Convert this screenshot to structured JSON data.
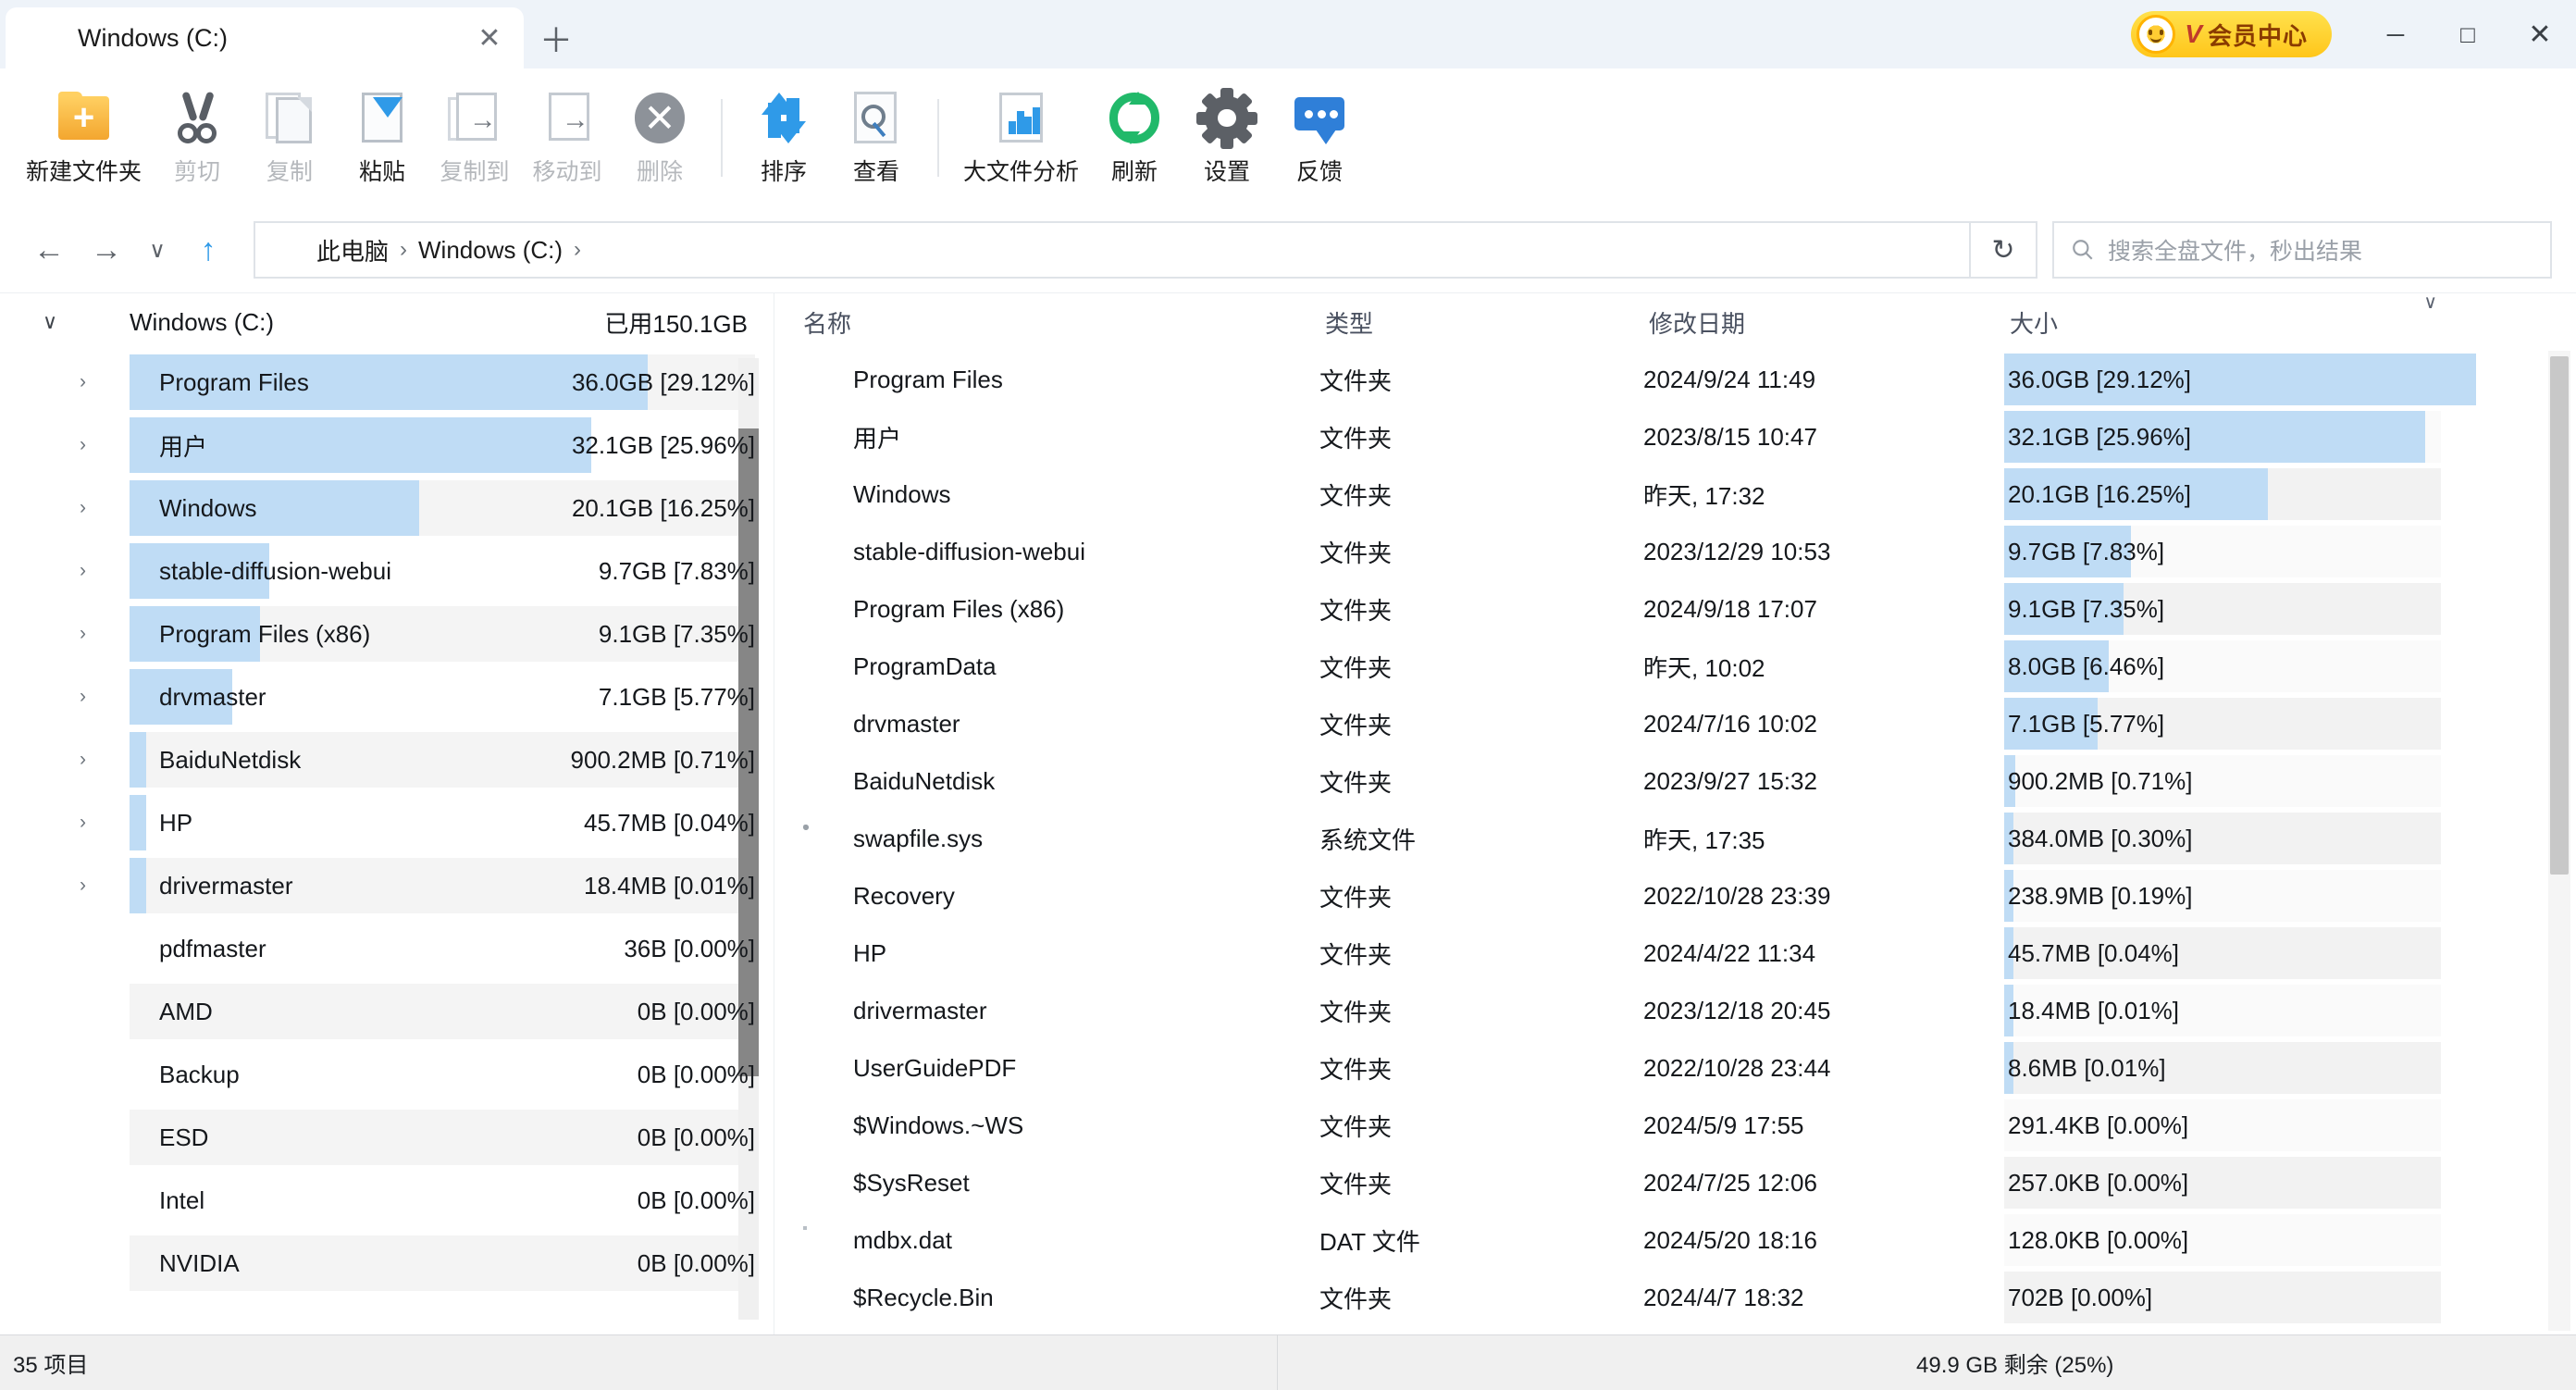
{
  "titlebar": {
    "tab_title": "Windows (C:)",
    "tab_icon": "drive-icon",
    "close_tab_glyph": "✕",
    "new_tab_glyph": "＋",
    "vip": {
      "v_letter": "V",
      "label": "会员中心"
    },
    "minimize_glyph": "─",
    "maximize_glyph": "□",
    "close_glyph": "✕"
  },
  "toolbar": {
    "buttons": [
      {
        "label": "新建文件夹",
        "icon": "new-folder-icon",
        "enabled": true
      },
      {
        "label": "剪切",
        "icon": "cut-icon",
        "enabled": false
      },
      {
        "label": "复制",
        "icon": "copy-icon",
        "enabled": false
      },
      {
        "label": "粘贴",
        "icon": "paste-icon",
        "enabled": true
      },
      {
        "label": "复制到",
        "icon": "copy-to-icon",
        "enabled": false
      },
      {
        "label": "移动到",
        "icon": "move-to-icon",
        "enabled": false
      },
      {
        "label": "删除",
        "icon": "delete-icon",
        "enabled": false
      },
      {
        "label": "排序",
        "icon": "sort-icon",
        "enabled": true
      },
      {
        "label": "查看",
        "icon": "view-icon",
        "enabled": true
      },
      {
        "label": "大文件分析",
        "icon": "big-file-analysis-icon",
        "enabled": true
      },
      {
        "label": "刷新",
        "icon": "refresh-icon",
        "enabled": true
      },
      {
        "label": "设置",
        "icon": "settings-gear-icon",
        "enabled": true
      },
      {
        "label": "反馈",
        "icon": "feedback-icon",
        "enabled": true
      }
    ]
  },
  "addressbar": {
    "back_glyph": "←",
    "forward_glyph": "→",
    "history_glyph": "∨",
    "up_glyph": "↑",
    "breadcrumbs": [
      "此电脑",
      "Windows (C:)"
    ],
    "separator": "›",
    "refresh_glyph": "↻",
    "search_icon": "search-icon",
    "search_placeholder": "搜索全盘文件，秒出结果",
    "search_value": ""
  },
  "sidebar": {
    "root": {
      "chevron": "∨",
      "label": "Windows (C:)",
      "used": "已用150.1GB"
    },
    "items": [
      {
        "name": "Program Files",
        "size": "36.0GB [29.12%]",
        "pct": 29.12,
        "expandable": true
      },
      {
        "name": "用户",
        "size": "32.1GB [25.96%]",
        "pct": 25.96,
        "expandable": true
      },
      {
        "name": "Windows",
        "size": "20.1GB [16.25%]",
        "pct": 16.25,
        "expandable": true
      },
      {
        "name": "stable-diffusion-webui",
        "size": "9.7GB [7.83%]",
        "pct": 7.83,
        "expandable": true
      },
      {
        "name": "Program Files (x86)",
        "size": "9.1GB [7.35%]",
        "pct": 7.35,
        "expandable": true
      },
      {
        "name": "drvmaster",
        "size": "7.1GB [5.77%]",
        "pct": 5.77,
        "expandable": true
      },
      {
        "name": "BaiduNetdisk",
        "size": "900.2MB [0.71%]",
        "pct": 0.71,
        "expandable": true
      },
      {
        "name": "HP",
        "size": "45.7MB [0.04%]",
        "pct": 0.04,
        "expandable": true
      },
      {
        "name": "drivermaster",
        "size": "18.4MB [0.01%]",
        "pct": 0.01,
        "expandable": true
      },
      {
        "name": "pdfmaster",
        "size": "36B [0.00%]",
        "pct": 0,
        "expandable": false
      },
      {
        "name": "AMD",
        "size": "0B [0.00%]",
        "pct": 0,
        "expandable": false
      },
      {
        "name": "Backup",
        "size": "0B [0.00%]",
        "pct": 0,
        "expandable": false
      },
      {
        "name": "ESD",
        "size": "0B [0.00%]",
        "pct": 0,
        "expandable": false
      },
      {
        "name": "Intel",
        "size": "0B [0.00%]",
        "pct": 0,
        "expandable": false
      },
      {
        "name": "NVIDIA",
        "size": "0B [0.00%]",
        "pct": 0,
        "expandable": false
      }
    ]
  },
  "filelist": {
    "columns": {
      "name": "名称",
      "type": "类型",
      "date": "修改日期",
      "size": "大小"
    },
    "sort_column": "大小",
    "sort_glyph": "∨",
    "rows": [
      {
        "name": "Program Files",
        "icon": "folder-icon",
        "type": "文件夹",
        "date": "2024/9/24 11:49",
        "size": "36.0GB [29.12%]",
        "pct": 29.12
      },
      {
        "name": "用户",
        "icon": "folder-icon",
        "type": "文件夹",
        "date": "2023/8/15 10:47",
        "size": "32.1GB [25.96%]",
        "pct": 25.96
      },
      {
        "name": "Windows",
        "icon": "folder-icon",
        "type": "文件夹",
        "date": "昨天, 17:32",
        "size": "20.1GB [16.25%]",
        "pct": 16.25
      },
      {
        "name": "stable-diffusion-webui",
        "icon": "folder-icon",
        "type": "文件夹",
        "date": "2023/12/29 10:53",
        "size": "9.7GB [7.83%]",
        "pct": 7.83
      },
      {
        "name": "Program Files (x86)",
        "icon": "folder-icon",
        "type": "文件夹",
        "date": "2024/9/18 17:07",
        "size": "9.1GB [7.35%]",
        "pct": 7.35
      },
      {
        "name": "ProgramData",
        "icon": "folder-pale-icon",
        "type": "文件夹",
        "date": "昨天, 10:02",
        "size": "8.0GB [6.46%]",
        "pct": 6.46
      },
      {
        "name": "drvmaster",
        "icon": "folder-icon",
        "type": "文件夹",
        "date": "2024/7/16 10:02",
        "size": "7.1GB [5.77%]",
        "pct": 5.77
      },
      {
        "name": "BaiduNetdisk",
        "icon": "folder-icon",
        "type": "文件夹",
        "date": "2023/9/27 15:32",
        "size": "900.2MB [0.71%]",
        "pct": 0.71
      },
      {
        "name": "swapfile.sys",
        "icon": "system-file-icon",
        "type": "系统文件",
        "date": "昨天, 17:35",
        "size": "384.0MB [0.30%]",
        "pct": 0.3
      },
      {
        "name": "Recovery",
        "icon": "folder-pale-icon",
        "type": "文件夹",
        "date": "2022/10/28 23:39",
        "size": "238.9MB [0.19%]",
        "pct": 0.19
      },
      {
        "name": "HP",
        "icon": "folder-icon",
        "type": "文件夹",
        "date": "2024/4/22 11:34",
        "size": "45.7MB [0.04%]",
        "pct": 0.04
      },
      {
        "name": "drivermaster",
        "icon": "folder-icon",
        "type": "文件夹",
        "date": "2023/12/18 20:45",
        "size": "18.4MB [0.01%]",
        "pct": 0.01
      },
      {
        "name": "UserGuidePDF",
        "icon": "folder-pale-icon",
        "type": "文件夹",
        "date": "2022/10/28 23:44",
        "size": "8.6MB [0.01%]",
        "pct": 0.01
      },
      {
        "name": "$Windows.~WS",
        "icon": "folder-pale-icon",
        "type": "文件夹",
        "date": "2024/5/9 17:55",
        "size": "291.4KB [0.00%]",
        "pct": 0
      },
      {
        "name": "$SysReset",
        "icon": "folder-pale-icon",
        "type": "文件夹",
        "date": "2024/7/25 12:06",
        "size": "257.0KB [0.00%]",
        "pct": 0
      },
      {
        "name": "mdbx.dat",
        "icon": "dat-file-icon",
        "type": "DAT 文件",
        "date": "2024/5/20 18:16",
        "size": "128.0KB [0.00%]",
        "pct": 0
      },
      {
        "name": "$Recycle.Bin",
        "icon": "folder-pale-icon",
        "type": "文件夹",
        "date": "2024/4/7 18:32",
        "size": "702B [0.00%]",
        "pct": 0
      }
    ]
  },
  "statusbar": {
    "item_count": "35 项目",
    "free_space": "49.9 GB 剩余 (25%)"
  },
  "colors": {
    "accent_blue": "#2f9ae8",
    "bar_blue": "#bfdcf5",
    "folder_yellow": "#fbc75c",
    "vip_yellow": "#ffc61a",
    "green": "#21b96a"
  }
}
